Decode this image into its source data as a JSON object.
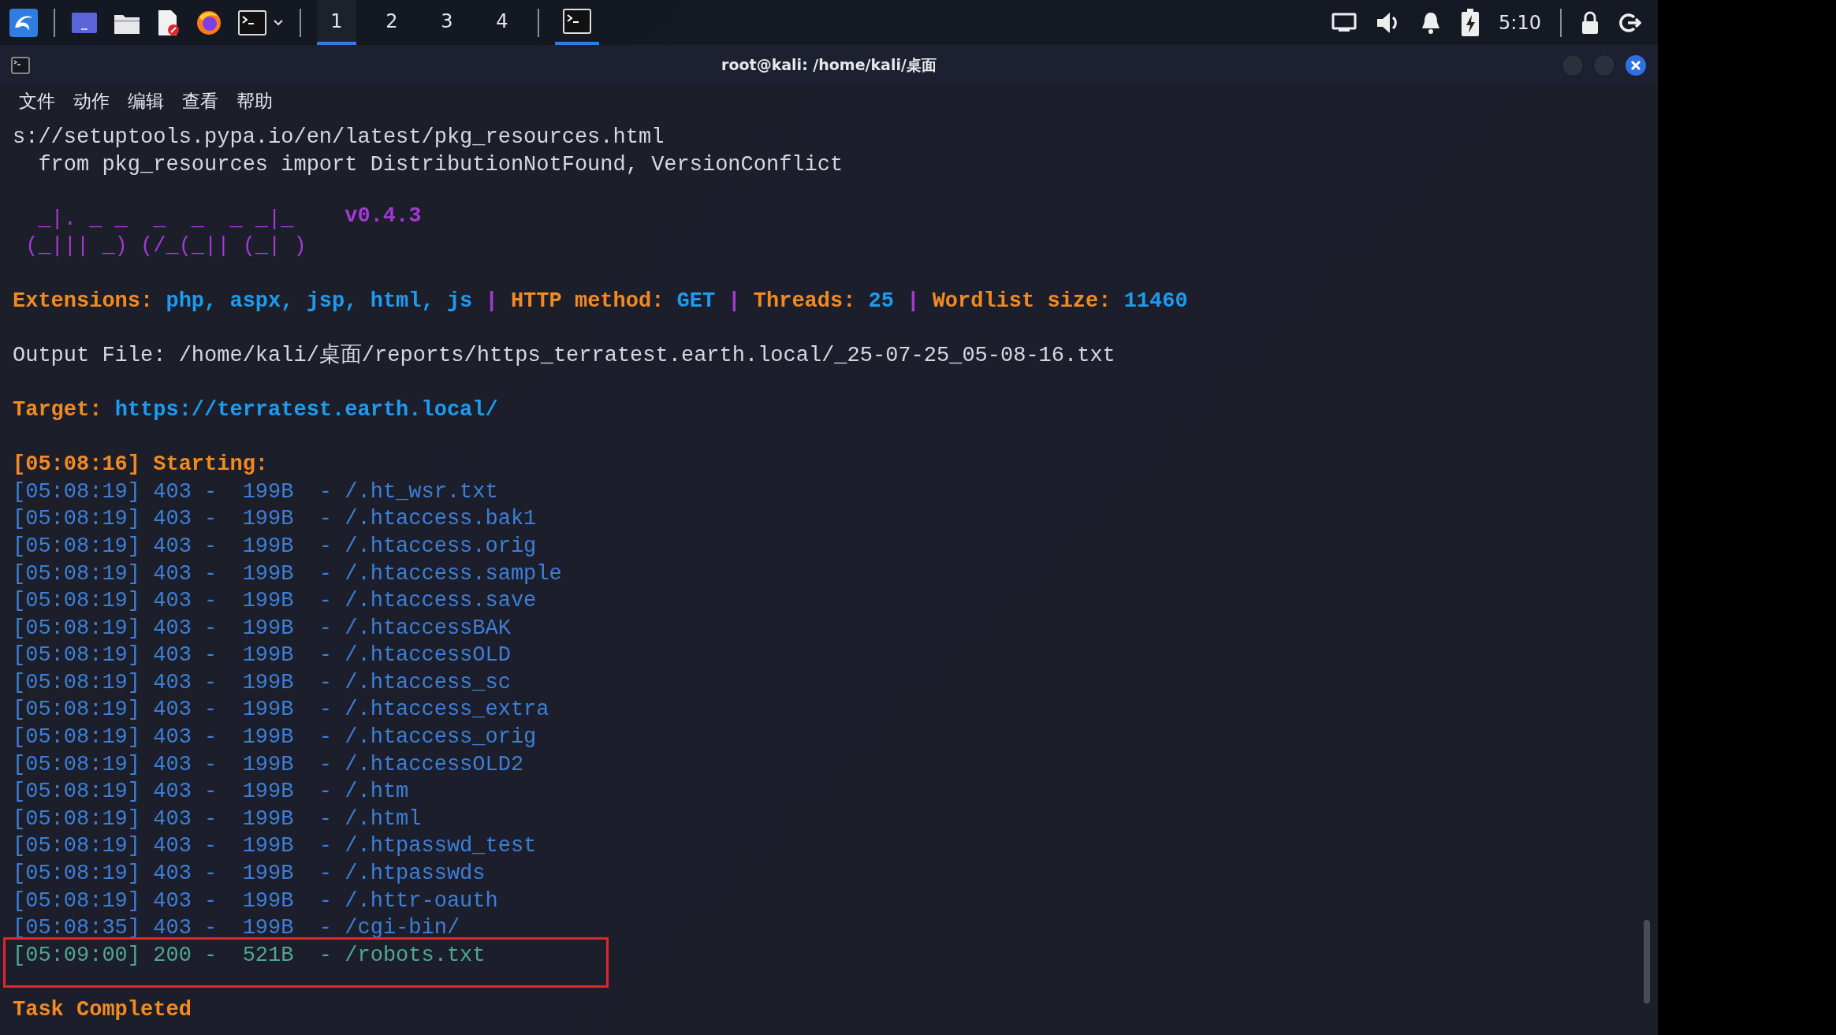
{
  "taskbar": {
    "workspaces": [
      {
        "label": "1",
        "selected": true
      },
      {
        "label": "2",
        "selected": false
      },
      {
        "label": "3",
        "selected": false
      },
      {
        "label": "4",
        "selected": false
      }
    ],
    "clock": "5:10"
  },
  "window": {
    "title": "root@kali: /home/kali/桌面",
    "menu": [
      "文件",
      "动作",
      "编辑",
      "查看",
      "帮助"
    ],
    "lines": [
      {
        "kind": "plain",
        "text": "s://setuptools.pypa.io/en/latest/pkg_resources.html"
      },
      {
        "kind": "plain",
        "text": "  from pkg_resources import DistributionNotFound, VersionConflict"
      },
      {
        "kind": "blank"
      },
      {
        "kind": "banner",
        "text": "  _|. _ _  _  _  _ _|_",
        "version": "v0.4.3"
      },
      {
        "kind": "banner",
        "text": " (_||| _) (/_(_|| (_| )"
      },
      {
        "kind": "blank"
      },
      {
        "kind": "info",
        "segments": [
          {
            "kind": "label",
            "text": "Extensions: "
          },
          {
            "kind": "value",
            "text": "php, aspx, jsp, html, js"
          },
          {
            "kind": "sep",
            "text": " | "
          },
          {
            "kind": "label",
            "text": "HTTP method: "
          },
          {
            "kind": "value",
            "text": "GET"
          },
          {
            "kind": "sep",
            "text": " | "
          },
          {
            "kind": "label",
            "text": "Threads: "
          },
          {
            "kind": "value",
            "text": "25"
          },
          {
            "kind": "sep",
            "text": " | "
          },
          {
            "kind": "label",
            "text": "Wordlist size: "
          },
          {
            "kind": "value",
            "text": "11460"
          }
        ]
      },
      {
        "kind": "blank"
      },
      {
        "kind": "plain",
        "text": "Output File: /home/kali/桌面/reports/https_terratest.earth.local/_25-07-25_05-08-16.txt"
      },
      {
        "kind": "blank"
      },
      {
        "kind": "info",
        "segments": [
          {
            "kind": "label",
            "text": "Target: "
          },
          {
            "kind": "value",
            "text": "https://terratest.earth.local/"
          }
        ]
      },
      {
        "kind": "blank"
      },
      {
        "kind": "heading",
        "text": "[05:08:16] Starting:"
      },
      {
        "kind": "result",
        "text": "[05:08:19] 403 -  199B  - /.ht_wsr.txt",
        "color": "#3d7fd8",
        "highlighted": false
      },
      {
        "kind": "result",
        "text": "[05:08:19] 403 -  199B  - /.htaccess.bak1",
        "color": "#3d7fd8",
        "highlighted": false
      },
      {
        "kind": "result",
        "text": "[05:08:19] 403 -  199B  - /.htaccess.orig",
        "color": "#3d7fd8",
        "highlighted": false
      },
      {
        "kind": "result",
        "text": "[05:08:19] 403 -  199B  - /.htaccess.sample",
        "color": "#3d7fd8",
        "highlighted": false
      },
      {
        "kind": "result",
        "text": "[05:08:19] 403 -  199B  - /.htaccess.save",
        "color": "#3d7fd8",
        "highlighted": false
      },
      {
        "kind": "result",
        "text": "[05:08:19] 403 -  199B  - /.htaccessBAK",
        "color": "#3d7fd8",
        "highlighted": false
      },
      {
        "kind": "result",
        "text": "[05:08:19] 403 -  199B  - /.htaccessOLD",
        "color": "#3d7fd8",
        "highlighted": false
      },
      {
        "kind": "result",
        "text": "[05:08:19] 403 -  199B  - /.htaccess_sc",
        "color": "#3d7fd8",
        "highlighted": false
      },
      {
        "kind": "result",
        "text": "[05:08:19] 403 -  199B  - /.htaccess_extra",
        "color": "#3d7fd8",
        "highlighted": false
      },
      {
        "kind": "result",
        "text": "[05:08:19] 403 -  199B  - /.htaccess_orig",
        "color": "#3d7fd8",
        "highlighted": false
      },
      {
        "kind": "result",
        "text": "[05:08:19] 403 -  199B  - /.htaccessOLD2",
        "color": "#3d7fd8",
        "highlighted": false
      },
      {
        "kind": "result",
        "text": "[05:08:19] 403 -  199B  - /.htm",
        "color": "#3d7fd8",
        "highlighted": false
      },
      {
        "kind": "result",
        "text": "[05:08:19] 403 -  199B  - /.html",
        "color": "#3d7fd8",
        "highlighted": false
      },
      {
        "kind": "result",
        "text": "[05:08:19] 403 -  199B  - /.htpasswd_test",
        "color": "#3d7fd8",
        "highlighted": false
      },
      {
        "kind": "result",
        "text": "[05:08:19] 403 -  199B  - /.htpasswds",
        "color": "#3d7fd8",
        "highlighted": false
      },
      {
        "kind": "result",
        "text": "[05:08:19] 403 -  199B  - /.httr-oauth",
        "color": "#3d7fd8",
        "highlighted": false
      },
      {
        "kind": "result",
        "text": "[05:08:35] 403 -  199B  - /cgi-bin/",
        "color": "#3d7fd8",
        "highlighted": false
      },
      {
        "kind": "result",
        "text": "[05:09:00] 200 -  521B  - /robots.txt",
        "color": "#4fa88e",
        "highlighted": true
      },
      {
        "kind": "blank"
      },
      {
        "kind": "heading",
        "text": "Task Completed"
      }
    ]
  }
}
